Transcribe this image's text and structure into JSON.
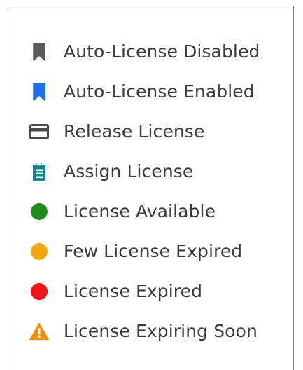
{
  "legend": {
    "items": [
      {
        "label": "Auto-License Disabled",
        "icon": "bookmark-icon",
        "color": "#5a5a5a"
      },
      {
        "label": "Auto-License Enabled",
        "icon": "bookmark-icon",
        "color": "#1f6fe5"
      },
      {
        "label": "Release License",
        "icon": "card-icon",
        "color": "#4a4a4a"
      },
      {
        "label": "Assign License",
        "icon": "clipboard-icon",
        "color": "#13838d"
      },
      {
        "label": "License Available",
        "icon": "status-dot-icon",
        "color": "#1f8a1f"
      },
      {
        "label": "Few License Expired",
        "icon": "status-dot-icon",
        "color": "#f4a60f"
      },
      {
        "label": "License Expired",
        "icon": "status-dot-icon",
        "color": "#f21414"
      },
      {
        "label": "License Expiring Soon",
        "icon": "warning-icon",
        "color": "#f28c00"
      }
    ]
  }
}
